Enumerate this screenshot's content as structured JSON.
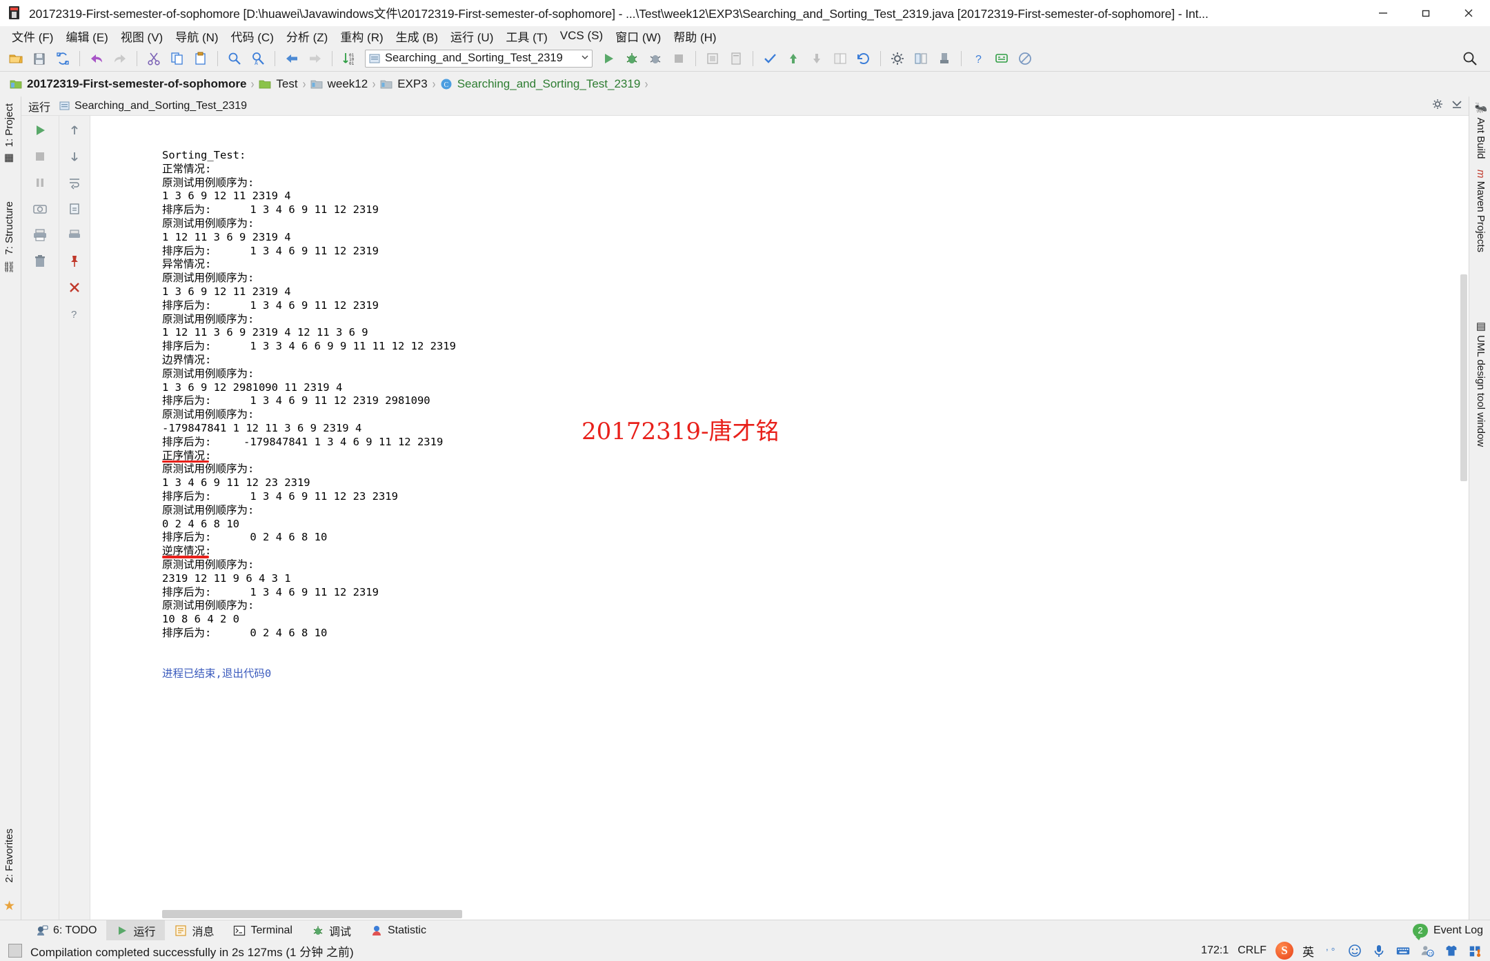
{
  "window": {
    "title": "20172319-First-semester-of-sophomore [D:\\huawei\\Javawindows文件\\20172319-First-semester-of-sophomore] - ...\\Test\\week12\\EXP3\\Searching_and_Sorting_Test_2319.java [20172319-First-semester-of-sophomore] - Int...",
    "app_icon": "intellij-idea-icon",
    "minimize_label": "最小化",
    "maximize_label": "最大化",
    "close_label": "关闭"
  },
  "menubar": {
    "items": [
      {
        "label": "文件 (F)",
        "name": "menu-file"
      },
      {
        "label": "编辑 (E)",
        "name": "menu-edit"
      },
      {
        "label": "视图 (V)",
        "name": "menu-view"
      },
      {
        "label": "导航 (N)",
        "name": "menu-navigate"
      },
      {
        "label": "代码 (C)",
        "name": "menu-code"
      },
      {
        "label": "分析 (Z)",
        "name": "menu-analyze"
      },
      {
        "label": "重构 (R)",
        "name": "menu-refactor"
      },
      {
        "label": "生成 (B)",
        "name": "menu-build"
      },
      {
        "label": "运行 (U)",
        "name": "menu-run"
      },
      {
        "label": "工具 (T)",
        "name": "menu-tools"
      },
      {
        "label": "VCS (S)",
        "name": "menu-vcs"
      },
      {
        "label": "窗口 (W)",
        "name": "menu-window"
      },
      {
        "label": "帮助 (H)",
        "name": "menu-help"
      }
    ]
  },
  "toolbar": {
    "icons": [
      "open-folder-icon",
      "save-all-icon",
      "sync-refresh-icon",
      "undo-icon",
      "redo-icon",
      "cut-icon",
      "copy-icon",
      "paste-icon",
      "find-icon",
      "replace-icon",
      "back-icon",
      "forward-icon",
      "sort-numeric-icon"
    ],
    "run_config": {
      "icon": "run-configuration-icon",
      "label": "Searching_and_Sorting_Test_2319",
      "dropdown_arrow": "chevron-down-icon"
    },
    "right_icons": [
      "run-icon",
      "debug-icon",
      "run-coverage-icon",
      "stop-icon",
      "build-project-icon",
      "checkmark-inspect-icon",
      "vcs-update-icon",
      "vcs-commit-icon",
      "vcs-revert-icon",
      "undo-vcs-icon",
      "settings-gear-icon",
      "project-structure-icon",
      "sdk-icon",
      "help-icon",
      "feedback-icon",
      "no-entry-icon"
    ],
    "search_everywhere": "search-everywhere-icon"
  },
  "breadcrumb": {
    "items": [
      {
        "label": "20172319-First-semester-of-sophomore",
        "icon": "project-module-icon",
        "kind": "root"
      },
      {
        "label": "Test",
        "icon": "source-folder-icon",
        "kind": "folder"
      },
      {
        "label": "week12",
        "icon": "folder-icon",
        "kind": "folder"
      },
      {
        "label": "EXP3",
        "icon": "folder-icon",
        "kind": "folder"
      },
      {
        "label": "Searching_and_Sorting_Test_2319",
        "icon": "java-class-icon",
        "kind": "file"
      }
    ],
    "separator": "›",
    "right_icons": [
      "settings-gear-icon",
      "hide-icon"
    ]
  },
  "left_tool_strip": {
    "items": [
      {
        "label": "1: Project",
        "icon": "project-icon"
      },
      {
        "label": "7: Structure",
        "icon": "structure-icon"
      },
      {
        "label": "2: Favorites",
        "icon": "favorites-star-icon"
      }
    ]
  },
  "right_tool_strip": {
    "items": [
      {
        "label": "Ant Build",
        "icon": "ant-icon"
      },
      {
        "label": "Maven Projects",
        "icon": "maven-m-icon"
      },
      {
        "label": "UML design tool window",
        "icon": "uml-icon"
      }
    ]
  },
  "run_window": {
    "title": "运行",
    "tab_label": "Searching_and_Sorting_Test_2319",
    "tab_icon": "run-config-tab-icon",
    "header_right_icons": [
      "gear-icon",
      "hide-window-icon"
    ],
    "sidebar_icons": [
      "rerun-green-icon",
      "stop-icon",
      "pause-icon",
      "camera-icon",
      "print-icon",
      "trash-icon"
    ],
    "sidebar2_icons": [
      "scroll-up-icon",
      "scroll-down-icon",
      "soft-wrap-icon",
      "print-icon",
      "export-icon",
      "pin-tab-icon",
      "close-icon",
      "help-icon"
    ]
  },
  "console": {
    "watermark": "20172319-唐才铭",
    "lines": [
      {
        "text": "Sorting_Test:",
        "style": "plain"
      },
      {
        "text": "正常情况:",
        "style": "plain"
      },
      {
        "text": "原测试用例顺序为:",
        "style": "plain"
      },
      {
        "text": "1 3 6 9 12 11 2319 4",
        "style": "plain"
      },
      {
        "text": "排序后为:      1 3 4 6 9 11 12 2319",
        "style": "plain"
      },
      {
        "text": "原测试用例顺序为:",
        "style": "plain"
      },
      {
        "text": "1 12 11 3 6 9 2319 4",
        "style": "plain"
      },
      {
        "text": "排序后为:      1 3 4 6 9 11 12 2319",
        "style": "plain"
      },
      {
        "text": "异常情况:",
        "style": "plain"
      },
      {
        "text": "原测试用例顺序为:",
        "style": "plain"
      },
      {
        "text": "1 3 6 9 12 11 2319 4",
        "style": "plain"
      },
      {
        "text": "排序后为:      1 3 4 6 9 11 12 2319",
        "style": "plain"
      },
      {
        "text": "原测试用例顺序为:",
        "style": "plain"
      },
      {
        "text": "1 12 11 3 6 9 2319 4 12 11 3 6 9",
        "style": "plain"
      },
      {
        "text": "排序后为:      1 3 3 4 6 6 9 9 11 11 12 12 2319",
        "style": "plain"
      },
      {
        "text": "边界情况:",
        "style": "plain"
      },
      {
        "text": "原测试用例顺序为:",
        "style": "plain"
      },
      {
        "text": "1 3 6 9 12 2981090 11 2319 4",
        "style": "plain"
      },
      {
        "text": "排序后为:      1 3 4 6 9 11 12 2319 2981090",
        "style": "plain"
      },
      {
        "text": "原测试用例顺序为:",
        "style": "plain"
      },
      {
        "text": "-179847841 1 12 11 3 6 9 2319 4",
        "style": "plain"
      },
      {
        "text": "排序后为:     -179847841 1 3 4 6 9 11 12 2319",
        "style": "plain"
      },
      {
        "text": "正序情况:",
        "style": "underlined"
      },
      {
        "text": "原测试用例顺序为:",
        "style": "plain"
      },
      {
        "text": "1 3 4 6 9 11 12 23 2319",
        "style": "plain"
      },
      {
        "text": "排序后为:      1 3 4 6 9 11 12 23 2319",
        "style": "plain"
      },
      {
        "text": "原测试用例顺序为:",
        "style": "plain"
      },
      {
        "text": "0 2 4 6 8 10",
        "style": "plain"
      },
      {
        "text": "排序后为:      0 2 4 6 8 10",
        "style": "plain"
      },
      {
        "text": "逆序情况:",
        "style": "underlined"
      },
      {
        "text": "原测试用例顺序为:",
        "style": "plain"
      },
      {
        "text": "2319 12 11 9 6 4 3 1",
        "style": "plain"
      },
      {
        "text": "排序后为:      1 3 4 6 9 11 12 2319",
        "style": "plain"
      },
      {
        "text": "原测试用例顺序为:",
        "style": "plain"
      },
      {
        "text": "10 8 6 4 2 0",
        "style": "plain"
      },
      {
        "text": "排序后为:      0 2 4 6 8 10",
        "style": "plain"
      },
      {
        "text": "",
        "style": "plain"
      },
      {
        "text": "进程已结束,退出代码0",
        "style": "exit"
      }
    ]
  },
  "bottom_bar": {
    "items": [
      {
        "label": "6: TODO",
        "icon": "todo-icon",
        "active": false,
        "mnemonic": "6"
      },
      {
        "label": "运行",
        "icon": "run-green-icon",
        "active": true,
        "mnemonic": ""
      },
      {
        "label": "消息",
        "icon": "messages-icon",
        "active": false,
        "mnemonic": ""
      },
      {
        "label": "Terminal",
        "icon": "terminal-icon",
        "active": false,
        "mnemonic": ""
      },
      {
        "label": "调试",
        "icon": "debug-bug-icon",
        "active": false,
        "mnemonic": ""
      },
      {
        "label": "Statistic",
        "icon": "statistic-icon",
        "active": false,
        "mnemonic": ""
      }
    ],
    "event_log": {
      "label": "Event Log",
      "count": "2",
      "icon": "event-log-icon"
    }
  },
  "status_bar": {
    "icon": "status-square-icon",
    "message": "Compilation completed successfully in 2s 127ms (1 分钟 之前)",
    "caret_position": "172:1",
    "line_separator": "CRLF",
    "ime": {
      "logo": "sogou-pinyin-icon",
      "mode": "英",
      "punctuation_icon": "punctuation-icon",
      "emoji_icon": "emoji-icon",
      "mic_icon": "microphone-icon",
      "keyboard_icon": "keyboard-icon",
      "user_icon": "user-icon",
      "skin_icon": "skin-shirt-icon",
      "toolbox_icon": "toolbox-icon"
    }
  },
  "colors": {
    "accent_green": "#4caf50",
    "watermark_red": "#e8201a",
    "exit_blue": "#3b5bbd",
    "chrome": "#f0f0f0"
  }
}
